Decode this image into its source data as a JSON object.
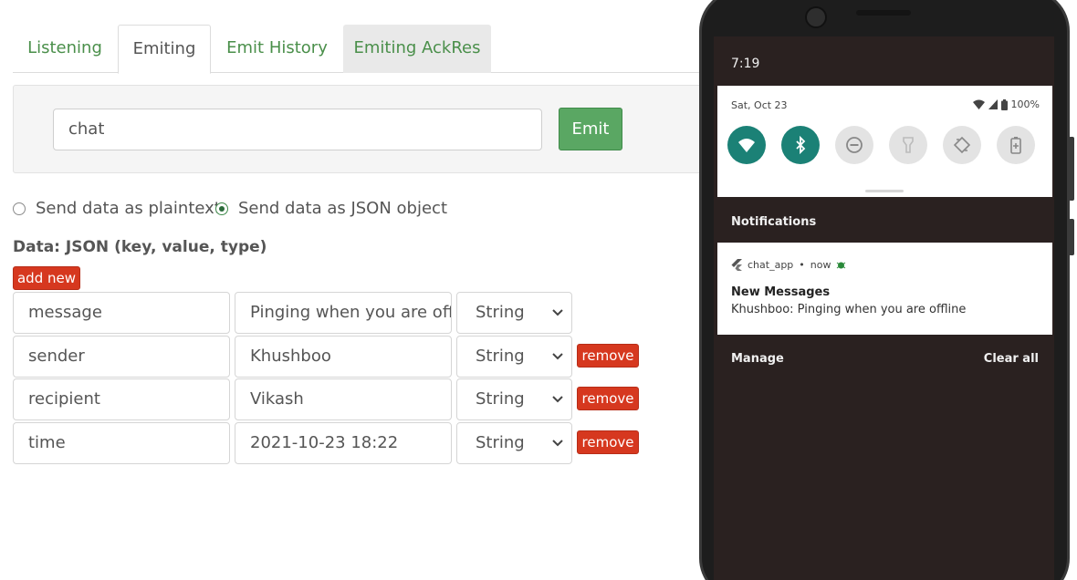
{
  "tabs": [
    {
      "label": "Listening"
    },
    {
      "label": "Emiting"
    },
    {
      "label": "Emit History"
    },
    {
      "label": "Emiting AckRes"
    }
  ],
  "event": {
    "name": "chat",
    "emit_label": "Emit"
  },
  "radios": {
    "plaintext_label": "Send data as plaintext",
    "json_label": "Send data as JSON object",
    "selected": "json"
  },
  "data_section": {
    "title": "Data: JSON (key, value, type)",
    "add_label": "add new"
  },
  "rows": [
    {
      "key": "message",
      "value": "Pinging when you are offline",
      "type": "String"
    },
    {
      "key": "sender",
      "value": "Khushboo",
      "type": "String",
      "remove_label": "remove"
    },
    {
      "key": "recipient",
      "value": "Vikash",
      "type": "String",
      "remove_label": "remove"
    },
    {
      "key": "time",
      "value": "2021-10-23 18:22",
      "type": "String",
      "remove_label": "remove"
    }
  ],
  "phone": {
    "clock": "7:19",
    "date": "Sat, Oct 23",
    "battery": "100%",
    "tiles": [
      {
        "icon": "wifi-icon",
        "state": "on"
      },
      {
        "icon": "bluetooth-icon",
        "state": "on"
      },
      {
        "icon": "do-not-disturb-icon",
        "state": "off"
      },
      {
        "icon": "flashlight-icon",
        "state": "off"
      },
      {
        "icon": "auto-rotate-icon",
        "state": "off"
      },
      {
        "icon": "battery-saver-icon",
        "state": "off"
      }
    ],
    "notifications_header": "Notifications",
    "notification": {
      "app": "chat_app",
      "time": "now",
      "title": "New Messages",
      "text": "Khushboo: Pinging when you are offline"
    },
    "manage_label": "Manage",
    "clear_all_label": "Clear all"
  },
  "colors": {
    "accent_green": "#5aa763",
    "danger_red": "#d6381f",
    "tile_teal": "#1b8176"
  }
}
